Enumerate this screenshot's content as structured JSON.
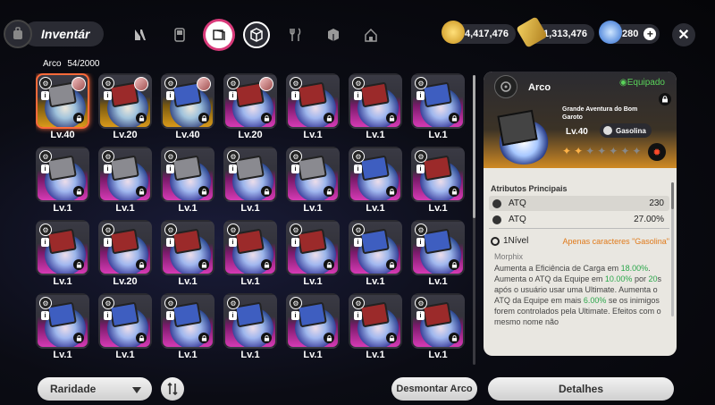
{
  "header": {
    "title": "Inventár",
    "categories": [
      {
        "icon": "n-logo-icon"
      },
      {
        "icon": "gamepad-icon"
      },
      {
        "icon": "disc-icon",
        "active": true
      },
      {
        "icon": "box-icon"
      },
      {
        "icon": "fork-knife-icon"
      },
      {
        "icon": "cube-icon"
      },
      {
        "icon": "home-icon"
      }
    ],
    "currencies": [
      {
        "icon": "gold-coin-icon",
        "value": "4,417,476",
        "color": "#e6b832"
      },
      {
        "icon": "ticket-icon",
        "value": "1,313,476",
        "color": "#e6c94a"
      },
      {
        "icon": "crystal-icon",
        "value": "280",
        "color": "#5aa0ff"
      }
    ],
    "close_label": "✕"
  },
  "list": {
    "label": "Arco",
    "count": "54/2000"
  },
  "items": [
    {
      "lv": "Lv.40",
      "rarity": "gold",
      "box": "gray",
      "selected": true,
      "avatar": true
    },
    {
      "lv": "Lv.20",
      "rarity": "gold",
      "box": "red",
      "avatar": true
    },
    {
      "lv": "Lv.40",
      "rarity": "gold",
      "box": "blue",
      "avatar": true
    },
    {
      "lv": "Lv.20",
      "rarity": "pink",
      "box": "red",
      "avatar": true
    },
    {
      "lv": "Lv.1",
      "rarity": "pink",
      "box": "red"
    },
    {
      "lv": "Lv.1",
      "rarity": "pink",
      "box": "red"
    },
    {
      "lv": "Lv.1",
      "rarity": "pink",
      "box": "blue"
    },
    {
      "lv": "Lv.1",
      "rarity": "pink",
      "box": "gray"
    },
    {
      "lv": "Lv.1",
      "rarity": "pink",
      "box": "gray"
    },
    {
      "lv": "Lv.1",
      "rarity": "pink",
      "box": "gray"
    },
    {
      "lv": "Lv.1",
      "rarity": "pink",
      "box": "gray"
    },
    {
      "lv": "Lv.1",
      "rarity": "pink",
      "box": "gray"
    },
    {
      "lv": "Lv.1",
      "rarity": "pink",
      "box": "blue"
    },
    {
      "lv": "Lv.1",
      "rarity": "pink",
      "box": "red"
    },
    {
      "lv": "Lv.1",
      "rarity": "pink",
      "box": "red"
    },
    {
      "lv": "Lv.20",
      "rarity": "pink",
      "box": "red"
    },
    {
      "lv": "Lv.1",
      "rarity": "pink",
      "box": "red"
    },
    {
      "lv": "Lv.1",
      "rarity": "pink",
      "box": "red"
    },
    {
      "lv": "Lv.1",
      "rarity": "pink",
      "box": "red"
    },
    {
      "lv": "Lv.1",
      "rarity": "pink",
      "box": "blue"
    },
    {
      "lv": "Lv.1",
      "rarity": "pink",
      "box": "blue"
    },
    {
      "lv": "Lv.1",
      "rarity": "pink",
      "box": "blue"
    },
    {
      "lv": "Lv.1",
      "rarity": "pink",
      "box": "blue"
    },
    {
      "lv": "Lv.1",
      "rarity": "pink",
      "box": "blue"
    },
    {
      "lv": "Lv.1",
      "rarity": "pink",
      "box": "blue"
    },
    {
      "lv": "Lv.1",
      "rarity": "pink",
      "box": "blue"
    },
    {
      "lv": "Lv.1",
      "rarity": "pink",
      "box": "red"
    },
    {
      "lv": "Lv.1",
      "rarity": "pink",
      "box": "red"
    }
  ],
  "detail": {
    "type_label": "Arco",
    "equipped_label": "◉Equipado",
    "name": "Grande Aventura do Bom Garoto",
    "level": "Lv.40",
    "character": "Gasolina",
    "stars_on": 2,
    "stars_total": 7,
    "section_title": "Atributos Principais",
    "stats": [
      {
        "label": "ATQ",
        "value": "230"
      },
      {
        "label": "ATQ",
        "value": "27.00%"
      }
    ],
    "level_label": "1Nível",
    "restriction": "Apenas caracteres \"Gasolina\"",
    "skill_name": "Morphix",
    "skill_parts": [
      {
        "t": "Aumenta a Eficiência de Carga em ",
        "hl": false
      },
      {
        "t": "18.00%",
        "hl": true
      },
      {
        "t": ". Aumenta o ATQ da Equipe em ",
        "hl": false
      },
      {
        "t": "10.00%",
        "hl": true
      },
      {
        "t": " por ",
        "hl": false
      },
      {
        "t": "20",
        "hl": true
      },
      {
        "t": "s após o usuário usar uma Ultimate. Aumenta o ATQ da Equipe em mais ",
        "hl": false
      },
      {
        "t": "6.00%",
        "hl": true
      },
      {
        "t": " se os inimigos forem controlados pela Ultimate. Efeitos com o mesmo nome não",
        "hl": false
      }
    ]
  },
  "footer": {
    "sort_label": "Raridade",
    "sort_toggle_icon": "sort-arrows-icon",
    "dismantle_label": "Desmontar Arco",
    "details_label": "Detalhes"
  }
}
